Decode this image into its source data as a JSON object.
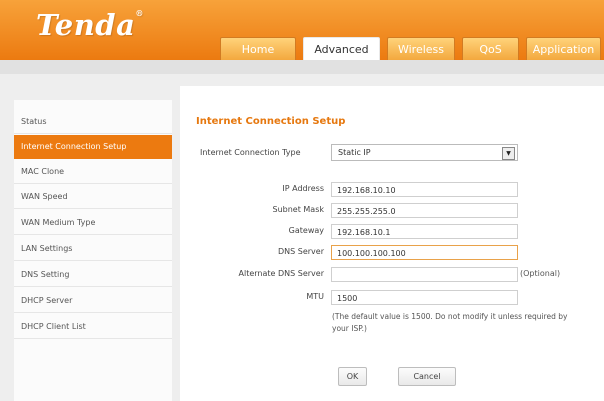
{
  "brand": {
    "name": "Tenda",
    "mark": "®"
  },
  "tabs": [
    {
      "label": "Home"
    },
    {
      "label": "Advanced"
    },
    {
      "label": "Wireless"
    },
    {
      "label": "QoS"
    },
    {
      "label": "Application"
    }
  ],
  "active_tab": "Advanced",
  "sidebar": {
    "items": [
      {
        "label": "Status"
      },
      {
        "label": "Internet Connection Setup"
      },
      {
        "label": "MAC Clone"
      },
      {
        "label": "WAN Speed"
      },
      {
        "label": "WAN Medium Type"
      },
      {
        "label": "LAN Settings"
      },
      {
        "label": "DNS Setting"
      },
      {
        "label": "DHCP Server"
      },
      {
        "label": "DHCP Client List"
      }
    ],
    "active": "Internet Connection Setup"
  },
  "form": {
    "title": "Internet Connection Setup",
    "connection_type": {
      "label": "Internet Connection Type",
      "value": "Static IP"
    },
    "ip_address": {
      "label": "IP Address",
      "value": "192.168.10.10"
    },
    "subnet_mask": {
      "label": "Subnet Mask",
      "value": "255.255.255.0"
    },
    "gateway": {
      "label": "Gateway",
      "value": "192.168.10.1"
    },
    "dns_server": {
      "label": "DNS Server",
      "value": "100.100.100.100"
    },
    "alt_dns_server": {
      "label": "Alternate DNS Server",
      "value": "",
      "note": "(Optional)"
    },
    "mtu": {
      "label": "MTU",
      "value": "1500",
      "hint": "(The default value is 1500. Do not modify it unless required by your ISP.)"
    },
    "ok_label": "OK",
    "cancel_label": "Cancel"
  },
  "colors": {
    "accent": "#ec7a10",
    "title": "#e6780f"
  }
}
